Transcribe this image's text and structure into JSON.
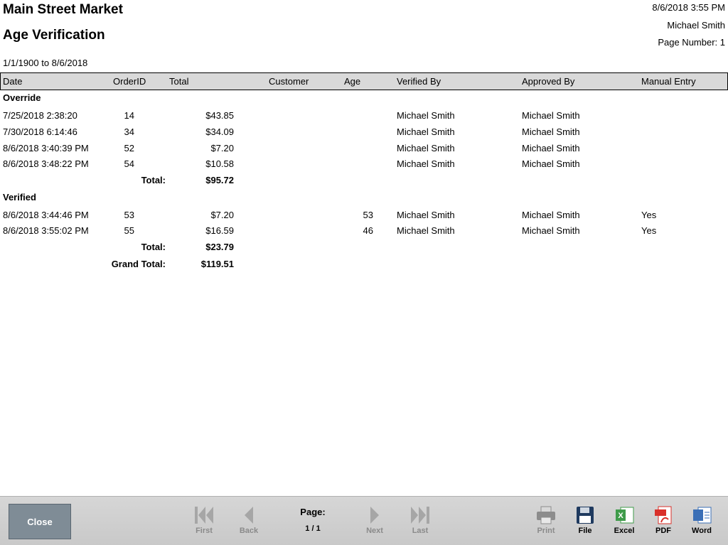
{
  "header": {
    "company": "Main Street Market",
    "title": "Age Verification",
    "date_range": "1/1/1900 to 8/6/2018",
    "printed_at": "8/6/2018 3:55 PM",
    "user": "Michael Smith",
    "page_number": "Page Number: 1"
  },
  "columns": {
    "date": "Date",
    "order_id": "OrderID",
    "total": "Total",
    "customer": "Customer",
    "age": "Age",
    "verified_by": "Verified By",
    "approved_by": "Approved By",
    "manual_entry": "Manual Entry"
  },
  "groups": [
    {
      "name": "Override",
      "rows": [
        {
          "date": "7/25/2018 2:38:20",
          "order_id": "14",
          "total": "$43.85",
          "customer": "",
          "age": "",
          "verified_by": "Michael Smith",
          "approved_by": "Michael Smith",
          "manual_entry": ""
        },
        {
          "date": "7/30/2018 6:14:46",
          "order_id": "34",
          "total": "$34.09",
          "customer": "",
          "age": "",
          "verified_by": "Michael Smith",
          "approved_by": "Michael Smith",
          "manual_entry": ""
        },
        {
          "date": "8/6/2018 3:40:39 PM",
          "order_id": "52",
          "total": "$7.20",
          "customer": "",
          "age": "",
          "verified_by": "Michael Smith",
          "approved_by": "Michael Smith",
          "manual_entry": ""
        },
        {
          "date": "8/6/2018 3:48:22 PM",
          "order_id": "54",
          "total": "$10.58",
          "customer": "",
          "age": "",
          "verified_by": "Michael Smith",
          "approved_by": "Michael Smith",
          "manual_entry": ""
        }
      ],
      "total_label": "Total:",
      "total_value": "$95.72"
    },
    {
      "name": "Verified",
      "rows": [
        {
          "date": "8/6/2018 3:44:46 PM",
          "order_id": "53",
          "total": "$7.20",
          "customer": "",
          "age": "53",
          "verified_by": "Michael Smith",
          "approved_by": "Michael Smith",
          "manual_entry": "Yes"
        },
        {
          "date": "8/6/2018 3:55:02 PM",
          "order_id": "55",
          "total": "$16.59",
          "customer": "",
          "age": "46",
          "verified_by": "Michael Smith",
          "approved_by": "Michael Smith",
          "manual_entry": "Yes"
        }
      ],
      "total_label": "Total:",
      "total_value": "$23.79"
    }
  ],
  "grand_total": {
    "label": "Grand Total:",
    "value": "$119.51"
  },
  "toolbar": {
    "close": "Close",
    "first": "First",
    "back": "Back",
    "page_label": "Page:",
    "page_value": "1 / 1",
    "next": "Next",
    "last": "Last",
    "print": "Print",
    "file": "File",
    "excel": "Excel",
    "pdf": "PDF",
    "word": "Word"
  },
  "icons": {
    "first": "first-page-icon",
    "back": "previous-page-icon",
    "next": "next-page-icon",
    "last": "last-page-icon",
    "print": "printer-icon",
    "file": "floppy-disk-icon",
    "excel": "excel-icon",
    "pdf": "pdf-icon",
    "word": "word-icon"
  },
  "colors": {
    "header_band": "#d9d9d9",
    "close_button": "#7f8c96",
    "excel": "#3f9b4a",
    "pdf": "#d9302a",
    "word": "#3b6fb6",
    "file": "#1f3a5f"
  }
}
